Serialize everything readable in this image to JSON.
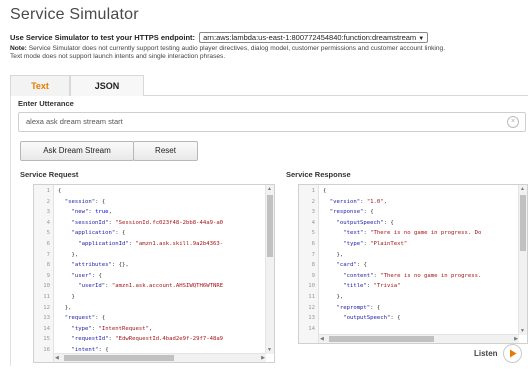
{
  "page": {
    "title": "Service Simulator",
    "endpoint_label": "Use Service Simulator to test your HTTPS endpoint:",
    "endpoint_value": "arn:aws:lambda:us-east-1:800772454840:function:dreamstream",
    "note_label": "Note:",
    "note_line1": "Service Simulator does not currently support testing audio player directives, dialog model, customer permissions and customer account linking.",
    "note_line2": "Text mode does not support launch intents and single interaction phrases."
  },
  "tabs": [
    {
      "label": "Text",
      "active": true
    },
    {
      "label": "JSON",
      "active": false
    }
  ],
  "utterance": {
    "label": "Enter Utterance",
    "value": "alexa ask dream stream start",
    "clear_icon": "clear-circle-icon"
  },
  "buttons": {
    "ask": "Ask Dream Stream",
    "reset": "Reset"
  },
  "request": {
    "label": "Service Request",
    "lines": [
      {
        "n": "1",
        "t": "{"
      },
      {
        "n": "2",
        "t": "  \"session\": {"
      },
      {
        "n": "3",
        "t": "    \"new\": true,"
      },
      {
        "n": "4",
        "t": "    \"sessionId\": \"SessionId.fc023f48-2bb8-44a9-a0"
      },
      {
        "n": "5",
        "t": "    \"application\": {"
      },
      {
        "n": "6",
        "t": "      \"applicationId\": \"amzn1.ask.skill.9a2b4363-"
      },
      {
        "n": "7",
        "t": "    },"
      },
      {
        "n": "8",
        "t": "    \"attributes\": {},"
      },
      {
        "n": "9",
        "t": "    \"user\": {"
      },
      {
        "n": "10",
        "t": "      \"userId\": \"amzn1.ask.account.AHSIWQTH6WTNRE"
      },
      {
        "n": "11",
        "t": "    }"
      },
      {
        "n": "12",
        "t": "  },"
      },
      {
        "n": "13",
        "t": "  \"request\": {"
      },
      {
        "n": "14",
        "t": "    \"type\": \"IntentRequest\","
      },
      {
        "n": "15",
        "t": "    \"requestId\": \"EdwRequestId.4bad2e9f-29f7-48a9"
      },
      {
        "n": "16",
        "t": "    \"intent\": {"
      }
    ]
  },
  "response": {
    "label": "Service Response",
    "lines": [
      {
        "n": "1",
        "t": "{"
      },
      {
        "n": "2",
        "t": "  \"version\": \"1.0\","
      },
      {
        "n": "3",
        "t": "  \"response\": {"
      },
      {
        "n": "4",
        "t": "    \"outputSpeech\": {"
      },
      {
        "n": "5",
        "t": "      \"text\": \"There is no game in progress. Do"
      },
      {
        "n": "6",
        "t": "      \"type\": \"PlainText\""
      },
      {
        "n": "7",
        "t": "    },"
      },
      {
        "n": "8",
        "t": "    \"card\": {"
      },
      {
        "n": "9",
        "t": "      \"content\": \"There is no game in progress."
      },
      {
        "n": "10",
        "t": "      \"title\": \"Trivia\""
      },
      {
        "n": "11",
        "t": "    },"
      },
      {
        "n": "12",
        "t": "    \"reprompt\": {"
      },
      {
        "n": "13",
        "t": "      \"outputSpeech\": {"
      },
      {
        "n": "14",
        "t": ""
      }
    ],
    "listen_label": "Listen"
  }
}
